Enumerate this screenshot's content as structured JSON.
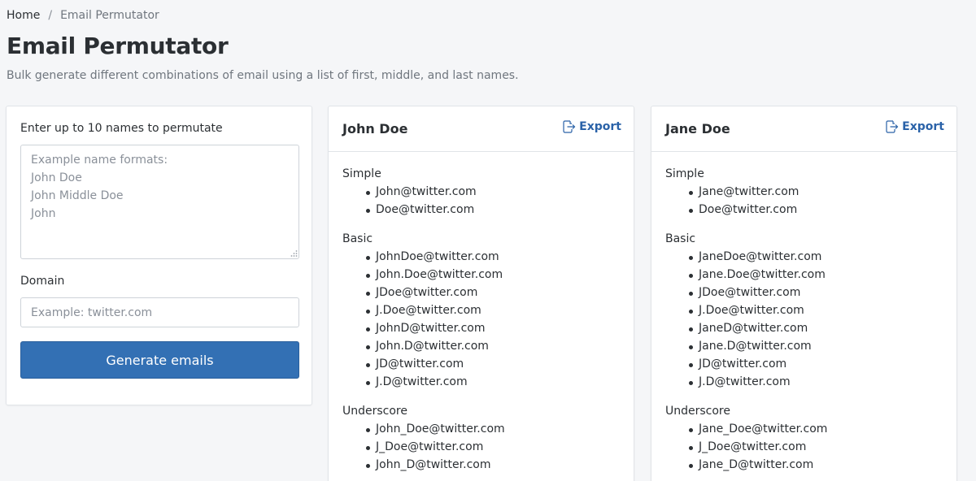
{
  "breadcrumb": {
    "home": "Home",
    "separator": "/",
    "current": "Email Permutator"
  },
  "page": {
    "title": "Email Permutator",
    "description": "Bulk generate different combinations of email using a list of first, middle, and last names."
  },
  "form": {
    "names_label": "Enter up to 10 names to permutate",
    "names_placeholder": "Example name formats:\nJohn Doe\nJohn Middle Doe\nJohn",
    "domain_label": "Domain",
    "domain_placeholder": "Example: twitter.com",
    "generate_label": "Generate emails"
  },
  "colors": {
    "primary": "#3370b4",
    "link": "#2a62a8",
    "background": "#f5f6f8"
  },
  "results": [
    {
      "name": "John Doe",
      "export_label": "Export",
      "groups": [
        {
          "title": "Simple",
          "emails": [
            "John@twitter.com",
            "Doe@twitter.com"
          ]
        },
        {
          "title": "Basic",
          "emails": [
            "JohnDoe@twitter.com",
            "John.Doe@twitter.com",
            "JDoe@twitter.com",
            "J.Doe@twitter.com",
            "JohnD@twitter.com",
            "John.D@twitter.com",
            "JD@twitter.com",
            "J.D@twitter.com"
          ]
        },
        {
          "title": "Underscore",
          "emails": [
            "John_Doe@twitter.com",
            "J_Doe@twitter.com",
            "John_D@twitter.com"
          ]
        }
      ]
    },
    {
      "name": "Jane Doe",
      "export_label": "Export",
      "groups": [
        {
          "title": "Simple",
          "emails": [
            "Jane@twitter.com",
            "Doe@twitter.com"
          ]
        },
        {
          "title": "Basic",
          "emails": [
            "JaneDoe@twitter.com",
            "Jane.Doe@twitter.com",
            "JDoe@twitter.com",
            "J.Doe@twitter.com",
            "JaneD@twitter.com",
            "Jane.D@twitter.com",
            "JD@twitter.com",
            "J.D@twitter.com"
          ]
        },
        {
          "title": "Underscore",
          "emails": [
            "Jane_Doe@twitter.com",
            "J_Doe@twitter.com",
            "Jane_D@twitter.com"
          ]
        }
      ]
    }
  ]
}
